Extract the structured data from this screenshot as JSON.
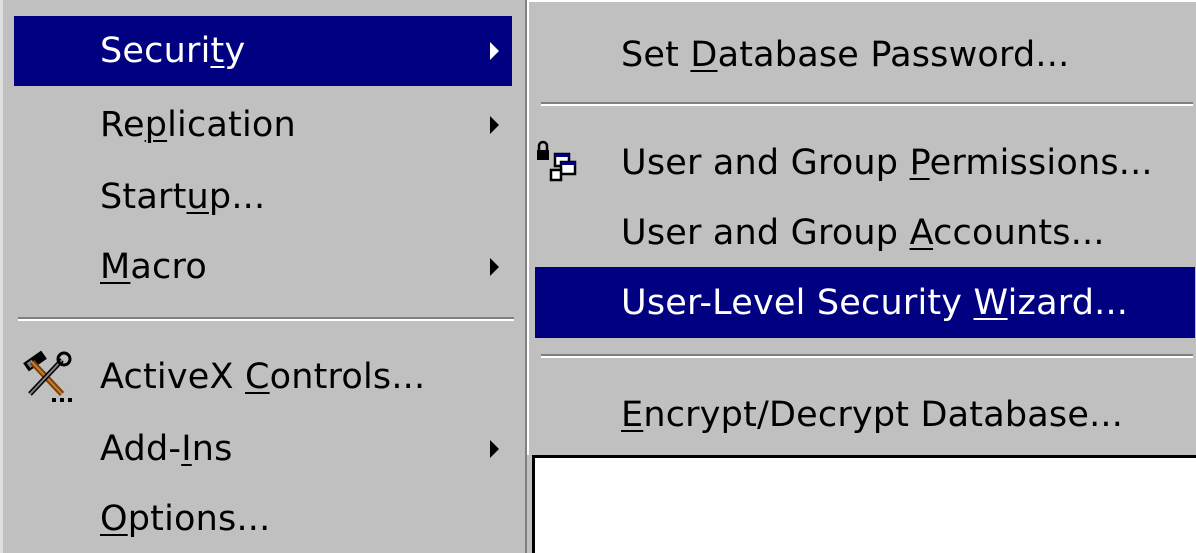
{
  "left_menu": {
    "items": [
      {
        "before": "Securi",
        "underline": "t",
        "after": "y",
        "has_submenu": true,
        "highlighted": true
      },
      {
        "before": "Re",
        "underline": "p",
        "after": "lication",
        "has_submenu": true,
        "highlighted": false
      },
      {
        "before": "Start",
        "underline": "u",
        "after": "p...",
        "has_submenu": false,
        "highlighted": false
      },
      {
        "before": "",
        "underline": "M",
        "after": "acro",
        "has_submenu": true,
        "highlighted": false
      },
      {
        "before": "ActiveX ",
        "underline": "C",
        "after": "ontrols...",
        "has_submenu": false,
        "highlighted": false,
        "icon": "activex-tools-icon"
      },
      {
        "before": "Add-",
        "underline": "I",
        "after": "ns",
        "has_submenu": true,
        "highlighted": false
      },
      {
        "before": "",
        "underline": "O",
        "after": "ptions...",
        "has_submenu": false,
        "highlighted": false
      }
    ]
  },
  "security_submenu": {
    "items": [
      {
        "before": "Set ",
        "underline": "D",
        "after": "atabase Password...",
        "highlighted": false
      },
      {
        "before": "User and Group ",
        "underline": "P",
        "after": "ermissions...",
        "highlighted": false,
        "icon": "lock-permissions-icon"
      },
      {
        "before": "User and Group ",
        "underline": "A",
        "after": "ccounts...",
        "highlighted": false
      },
      {
        "before": "User-Level Security ",
        "underline": "W",
        "after": "izard...",
        "highlighted": true
      },
      {
        "before": "",
        "underline": "E",
        "after": "ncrypt/Decrypt Database...",
        "highlighted": false
      }
    ]
  },
  "colors": {
    "menu_bg": "#c0c0c0",
    "highlight_bg": "#000080",
    "highlight_text": "#ffffff",
    "text": "#000000"
  }
}
